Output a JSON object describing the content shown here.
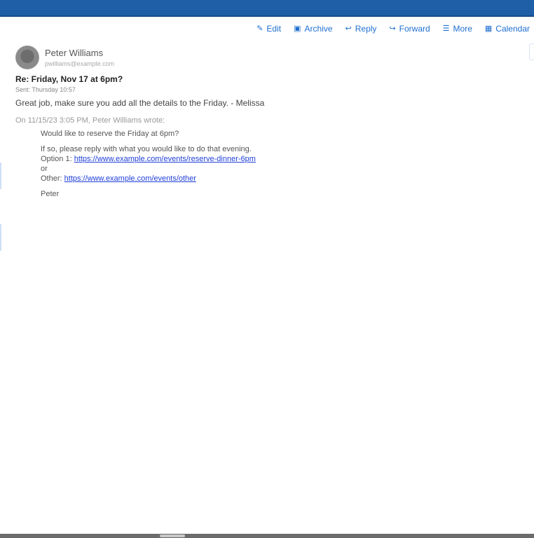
{
  "toolbar": {
    "buttons": [
      {
        "label": "Edit",
        "icon": "pencil-icon"
      },
      {
        "label": "Archive",
        "icon": "archive-icon"
      },
      {
        "label": "Reply",
        "icon": "reply-icon"
      },
      {
        "label": "Forward",
        "icon": "forward-icon"
      },
      {
        "label": "More",
        "icon": "more-icon"
      },
      {
        "label": "Calendar",
        "icon": "calendar-icon"
      }
    ]
  },
  "message": {
    "sender_name": "Peter Williams",
    "sender_email": "pwilliams@example.com",
    "subject": "Re: Friday, Nov 17 at 6pm?",
    "meta": "Sent: Thursday 10:57",
    "body": "Great job, make sure you add all the details to the Friday. - Melissa",
    "quote_header": "On 11/15/23 3:05 PM, Peter Williams wrote:",
    "quoted": {
      "line1": "Would like to reserve the Friday at 6pm?",
      "line2": "If so, please reply with what you would like to do that evening.",
      "label_a": "Option 1:",
      "link_a": "https://www.example.com/events/reserve-dinner-6pm",
      "or_text": "or",
      "label_b": "Other:",
      "link_b": "https://www.example.com/events/other",
      "sign": "Peter"
    }
  }
}
